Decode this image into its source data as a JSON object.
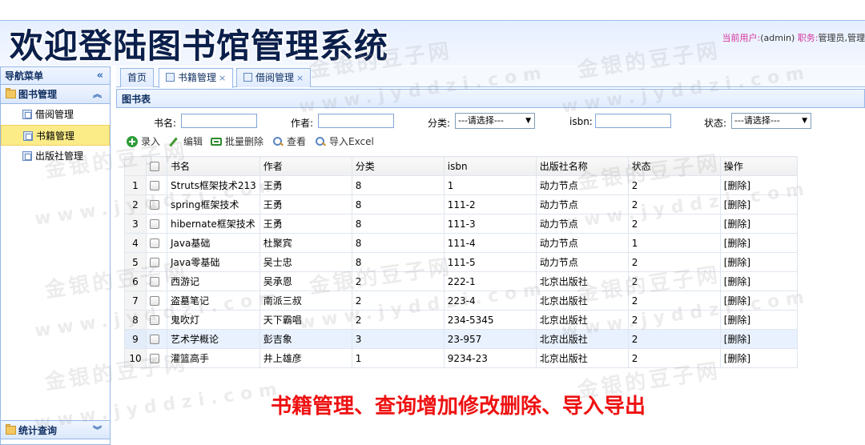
{
  "header": {
    "title": "欢迎登陆图书馆管理系统",
    "user_label": "当前用户:",
    "user_value": "(admin)",
    "role_label": "职务:",
    "role_value": "管理员,管理"
  },
  "nav": {
    "title": "导航菜单",
    "collapse_icon": "«",
    "group_book": {
      "label": "图书管理",
      "items": [
        {
          "label": "借阅管理"
        },
        {
          "label": "书籍管理"
        },
        {
          "label": "出版社管理"
        }
      ]
    },
    "group_stats": {
      "label": "统计查询"
    }
  },
  "tabs": [
    {
      "label": "首页"
    },
    {
      "label": "书籍管理",
      "close": "×"
    },
    {
      "label": "借阅管理",
      "close": "×"
    }
  ],
  "panel": {
    "title": "图书表"
  },
  "search": {
    "book_name_label": "书名:",
    "author_label": "作者:",
    "category_label": "分类:",
    "category_value": "---请选择---",
    "isbn_label": "isbn:",
    "status_label": "状态:",
    "status_value": "---请选择---"
  },
  "toolbar": {
    "add": "录入",
    "edit": "编辑",
    "batch_delete": "批量删除",
    "view": "查看",
    "import": "导入Excel"
  },
  "grid": {
    "columns": [
      "书名",
      "作者",
      "分类",
      "isbn",
      "出版社名称",
      "状态",
      "操作"
    ],
    "rows": [
      {
        "n": "1",
        "title": "Struts框架技术213",
        "author": "王勇",
        "cat": "8",
        "isbn": "1",
        "pub": "动力节点",
        "status": "2",
        "op": "[删除]"
      },
      {
        "n": "2",
        "title": "spring框架技术",
        "author": "王勇",
        "cat": "8",
        "isbn": "111-2",
        "pub": "动力节点",
        "status": "2",
        "op": "[删除]"
      },
      {
        "n": "3",
        "title": "hibernate框架技术",
        "author": "王勇",
        "cat": "8",
        "isbn": "111-3",
        "pub": "动力节点",
        "status": "2",
        "op": "[删除]"
      },
      {
        "n": "4",
        "title": "Java基础",
        "author": "杜聚宾",
        "cat": "8",
        "isbn": "111-4",
        "pub": "动力节点",
        "status": "1",
        "op": "[删除]"
      },
      {
        "n": "5",
        "title": "Java零基础",
        "author": "吴士忠",
        "cat": "8",
        "isbn": "111-5",
        "pub": "动力节点",
        "status": "2",
        "op": "[删除]"
      },
      {
        "n": "6",
        "title": "西游记",
        "author": "吴承恩",
        "cat": "2",
        "isbn": "222-1",
        "pub": "北京出版社",
        "status": "2",
        "op": "[删除]"
      },
      {
        "n": "7",
        "title": "盗墓笔记",
        "author": "南派三叔",
        "cat": "2",
        "isbn": "223-4",
        "pub": "北京出版社",
        "status": "2",
        "op": "[删除]"
      },
      {
        "n": "8",
        "title": "鬼吹灯",
        "author": "天下霸唱",
        "cat": "2",
        "isbn": "234-5345",
        "pub": "北京出版社",
        "status": "2",
        "op": "[删除]"
      },
      {
        "n": "9",
        "title": "艺术学概论",
        "author": "彭吉象",
        "cat": "3",
        "isbn": "23-957",
        "pub": "北京出版社",
        "status": "2",
        "op": "[删除]"
      },
      {
        "n": "10",
        "title": "灌篮高手",
        "author": "井上雄彦",
        "cat": "1",
        "isbn": "9234-23",
        "pub": "北京出版社",
        "status": "2",
        "op": "[删除]"
      }
    ]
  },
  "watermark": {
    "cn": "金银的豆子网",
    "url": "www.jyddzi.com"
  },
  "caption": "书籍管理、查询增加修改删除、导入导出"
}
